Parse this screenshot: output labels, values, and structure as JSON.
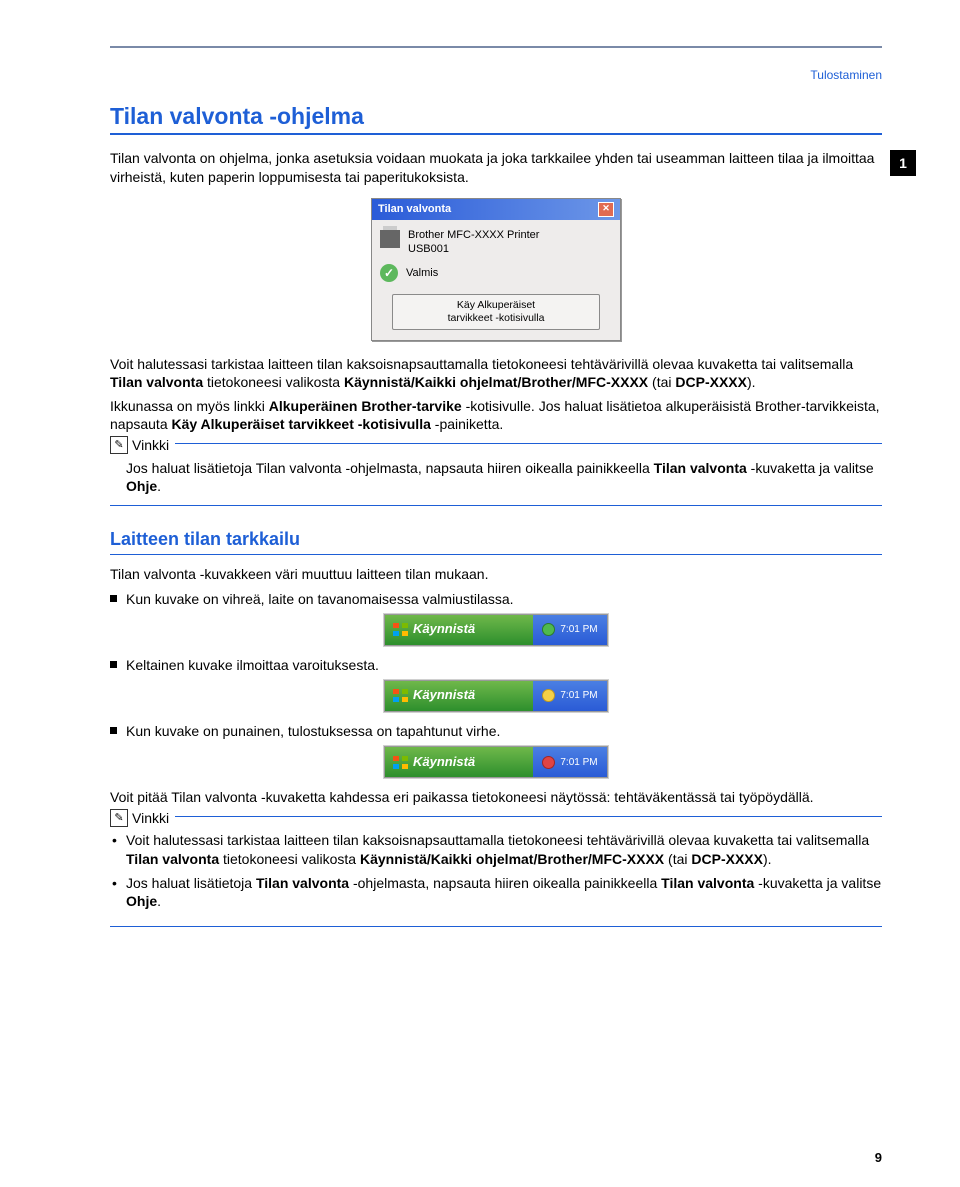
{
  "breadcrumb": "Tulostaminen",
  "chapter_number": "1",
  "h1": "Tilan valvonta -ohjelma",
  "intro": "Tilan valvonta on ohjelma, jonka asetuksia voidaan muokata ja joka tarkkailee yhden tai useamman laitteen tilaa ja ilmoittaa virheistä, kuten paperin loppumisesta tai paperitukoksista.",
  "dialog": {
    "title": "Tilan valvonta",
    "line1": "Brother MFC-XXXX Printer",
    "line2": "USB001",
    "status": "Valmis",
    "button_l1": "Käy Alkuperäiset",
    "button_l2": "tarvikkeet -kotisivulla"
  },
  "para2_pre": "Voit halutessasi tarkistaa laitteen tilan kaksoisnapsauttamalla tietokoneesi tehtävärivillä olevaa kuvaketta tai valitsemalla ",
  "para2_b1": "Tilan valvonta",
  "para2_mid": " tietokoneesi valikosta ",
  "para2_b2": "Käynnistä/Kaikki ohjelmat/Brother/MFC-XXXX",
  "para2_post": " (tai ",
  "para2_b3": "DCP-XXXX",
  "para2_end": ").",
  "para3_a": "Ikkunassa on myös linkki ",
  "para3_b1": "Alkuperäinen Brother-tarvike",
  "para3_mid": " -kotisivulle. Jos haluat lisätietoa alkuperäisistä Brother-tarvikkeista, napsauta ",
  "para3_b2": "Käy Alkuperäiset tarvikkeet -kotisivulla",
  "para3_end": " -painiketta.",
  "note_label": "Vinkki",
  "note1_a": "Jos haluat lisätietoja Tilan valvonta -ohjelmasta, napsauta hiiren oikealla painikkeella ",
  "note1_b": "Tilan valvonta",
  "note1_c": " -kuvaketta ja valitse ",
  "note1_d": "Ohje",
  "note1_e": ".",
  "h2": "Laitteen tilan tarkkailu",
  "mon_intro": "Tilan valvonta -kuvakkeen väri muuttuu laitteen tilan mukaan.",
  "bullet_green": "Kun kuvake on vihreä, laite on tavanomaisessa valmiustilassa.",
  "bullet_yellow": "Keltainen kuvake ilmoittaa varoituksesta.",
  "bullet_red": "Kun kuvake on punainen, tulostuksessa on tapahtunut virhe.",
  "start_label": "Käynnistä",
  "tray_time": "7:01 PM",
  "para_keep": "Voit pitää Tilan valvonta -kuvaketta kahdessa eri paikassa tietokoneesi näytössä: tehtäväkentässä tai työpöydällä.",
  "note2_i1_a": "Voit halutessasi tarkistaa laitteen tilan kaksoisnapsauttamalla tietokoneesi tehtävärivillä olevaa kuvaketta tai valitsemalla ",
  "note2_i1_b1": "Tilan valvonta",
  "note2_i1_mid": " tietokoneesi valikosta ",
  "note2_i1_b2": "Käynnistä/Kaikki ohjelmat/Brother/MFC-XXXX",
  "note2_i1_post": " (tai ",
  "note2_i1_b3": "DCP-XXXX",
  "note2_i1_end": ").",
  "note2_i2_a": "Jos haluat lisätietoja ",
  "note2_i2_b1": "Tilan valvonta",
  "note2_i2_mid": " -ohjelmasta, napsauta hiiren oikealla painikkeella ",
  "note2_i2_b2": "Tilan valvonta",
  "note2_i2_post": " -kuvaketta ja valitse ",
  "note2_i2_b3": "Ohje",
  "note2_i2_end": ".",
  "page_number": "9"
}
